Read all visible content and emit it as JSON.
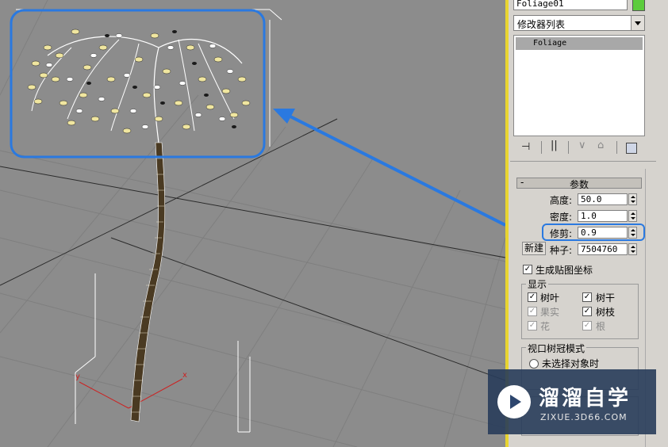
{
  "viewport": {
    "axis_x_label": "x",
    "axis_y_label": "y",
    "highlight_color": "#2a79e0"
  },
  "panel": {
    "object_name": "Foliage01",
    "object_color": "#5ccc3c",
    "modifier_list_label": "修改器列表",
    "stack_item": "Foliage",
    "rollout_toggle": "-",
    "rollout_title": "参数",
    "params": {
      "height_label": "高度:",
      "height_value": "50.0",
      "density_label": "密度:",
      "density_value": "1.0",
      "prune_label": "修剪:",
      "prune_value": "0.9",
      "new_button": "新建",
      "seed_label": "种子:",
      "seed_value": "7504760",
      "gen_mapping_label": "生成贴图坐标",
      "gen_mapping_checked": true
    },
    "display_group": {
      "title": "显示",
      "items": [
        {
          "label": "树叶",
          "checked": true,
          "enabled": true
        },
        {
          "label": "树干",
          "checked": true,
          "enabled": true
        },
        {
          "label": "果实",
          "checked": true,
          "enabled": false
        },
        {
          "label": "树枝",
          "checked": true,
          "enabled": true
        },
        {
          "label": "花",
          "checked": true,
          "enabled": false
        },
        {
          "label": "根",
          "checked": true,
          "enabled": false
        }
      ]
    },
    "canopy_group": {
      "title": "视口树冠模式",
      "option_1": "未选择对象时"
    }
  },
  "watermark": {
    "brand": "溜溜自学",
    "url": "ZIXUE.3D66.COM"
  }
}
